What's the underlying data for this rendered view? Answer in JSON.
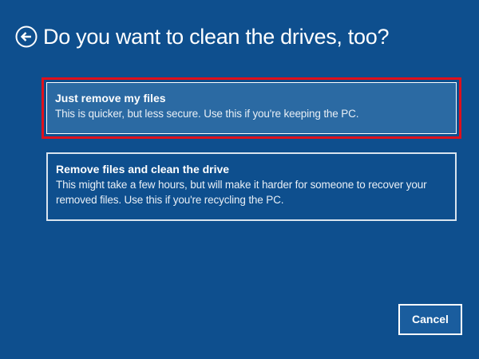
{
  "header": {
    "title": "Do you want to clean the drives, too?",
    "back_icon": "back-arrow-icon"
  },
  "options": [
    {
      "title": "Just remove my files",
      "description": "This is quicker, but less secure. Use this if you're keeping the PC.",
      "selected": true
    },
    {
      "title": "Remove files and clean the drive",
      "description": "This might take a few hours, but will make it harder for someone to recover your removed files. Use this if you're recycling the PC.",
      "selected": false
    }
  ],
  "footer": {
    "cancel_label": "Cancel"
  },
  "colors": {
    "background": "#0e4f8e",
    "selected_option": "#2b6aa3",
    "highlight_border": "#e0101c",
    "text": "#ffffff"
  }
}
